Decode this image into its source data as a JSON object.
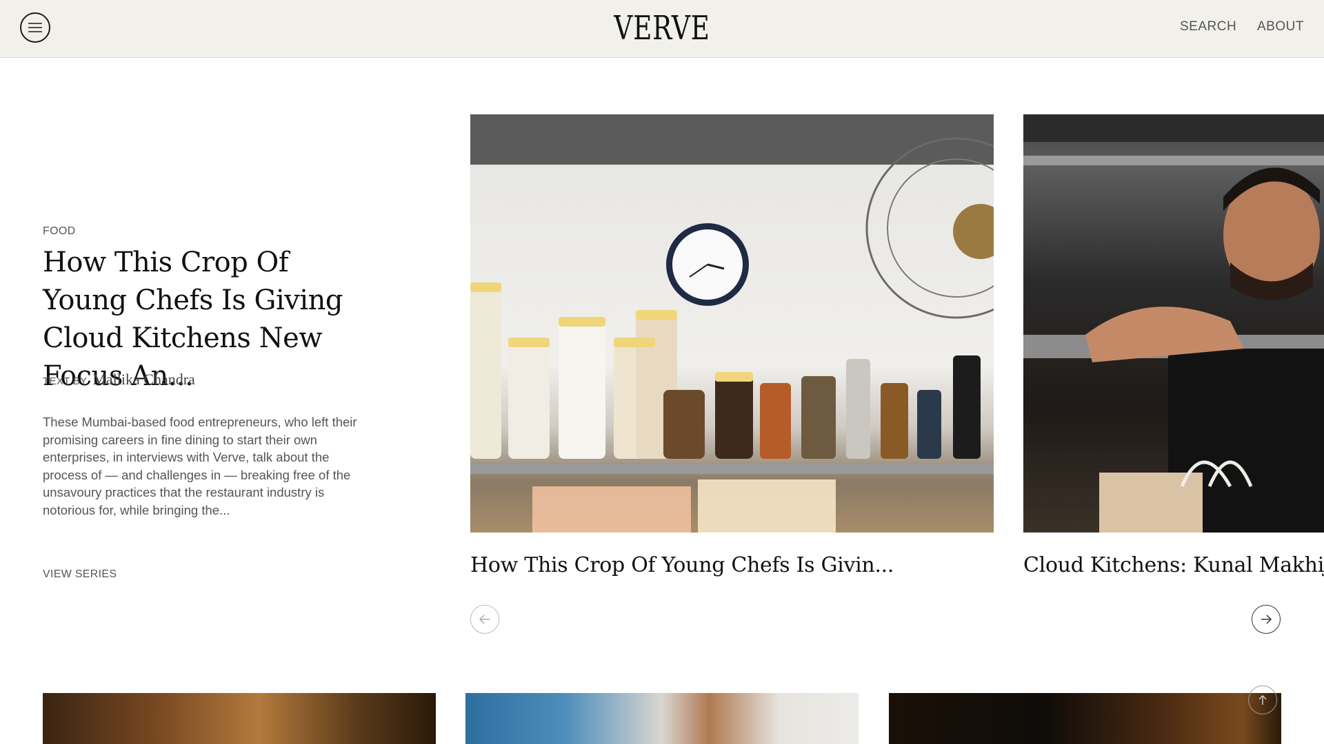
{
  "header": {
    "logo": "VERVE",
    "menu_icon": "hamburger-menu-icon",
    "nav": {
      "search": "SEARCH",
      "about": "ABOUT"
    }
  },
  "feature": {
    "category": "FOOD",
    "title": "How This Crop Of Young Chefs Is Giving Cloud Kitchens New Focus An...",
    "byline_label": "TEXT BY",
    "author": "Mallika Chandra",
    "excerpt": "These Mumbai-based food entrepreneurs, who left their promising careers in fine dining to start their own enterprises, in interviews with Verve, talk about the process of — and challenges in — breaking free of the unsavoury practices that the restaurant industry is notorious for, while bringing the...",
    "view_series": "VIEW SERIES"
  },
  "carousel": {
    "items": [
      {
        "caption": "How This Crop Of Young Chefs Is Givin..."
      },
      {
        "caption": "Cloud Kitchens: Kunal Makhija"
      }
    ],
    "prev_icon": "arrow-left-icon",
    "next_icon": "arrow-right-icon"
  },
  "back_to_top_icon": "arrow-up-icon"
}
